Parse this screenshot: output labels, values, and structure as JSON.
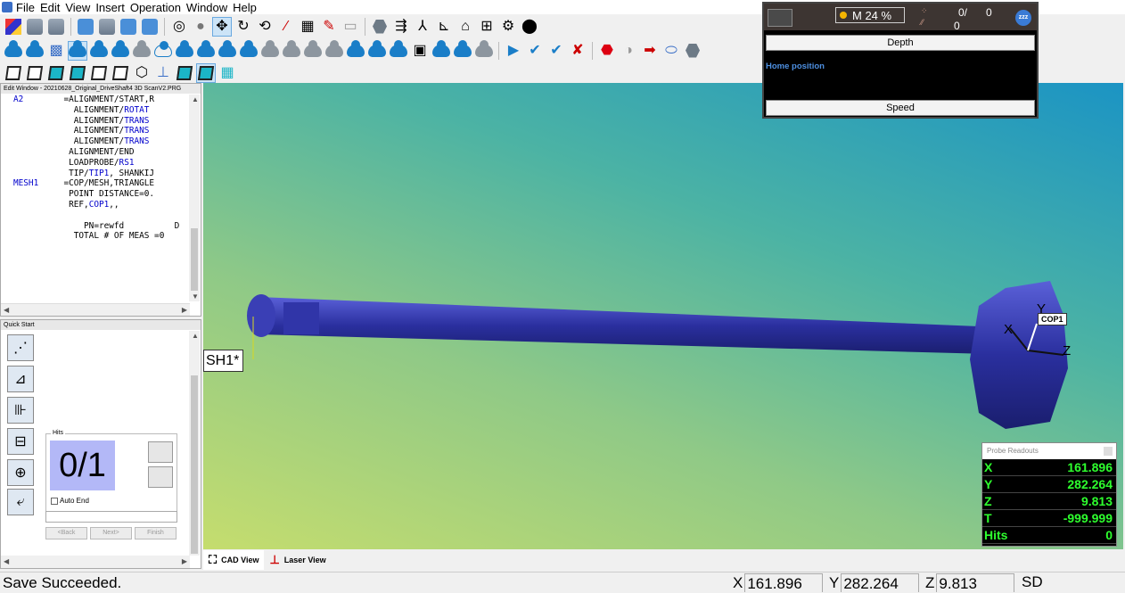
{
  "menu": [
    "File",
    "Edit",
    "View",
    "Insert",
    "Operation",
    "Window",
    "Help"
  ],
  "edit_window": {
    "title": "Edit Window - 20210628_Original_DriveShaft4 3D ScanV2.PRG",
    "lines": [
      {
        "label": "A2",
        "text": "=ALIGNMENT/START,R",
        "keyword": ""
      },
      {
        "label": "",
        "text": "  ALIGNMENT/",
        "keyword": "ROTAT"
      },
      {
        "label": "",
        "text": "  ALIGNMENT/",
        "keyword": "TRANS"
      },
      {
        "label": "",
        "text": "  ALIGNMENT/",
        "keyword": "TRANS"
      },
      {
        "label": "",
        "text": "  ALIGNMENT/",
        "keyword": "TRANS"
      },
      {
        "label": "",
        "text": " ALIGNMENT/END",
        "keyword": ""
      },
      {
        "label": "",
        "text": " LOADPROBE/",
        "keyword": "RS1"
      },
      {
        "label": "",
        "text": " TIP/",
        "keyword": "TIP1",
        "suffix": ", SHANKIJ"
      },
      {
        "label": "MESH1",
        "text": "=COP/MESH,TRIANGLE",
        "keyword": ""
      },
      {
        "label": "",
        "text": " POINT DISTANCE=0.",
        "keyword": ""
      },
      {
        "label": "",
        "text": " REF,",
        "keyword": "COP1",
        "suffix": ",,"
      },
      {
        "label": "",
        "text": "",
        "keyword": ""
      },
      {
        "label": "",
        "text": "    PN=rewfd          D",
        "keyword": ""
      },
      {
        "label": "",
        "text": "  TOTAL # OF MEAS =0      #",
        "keyword": ""
      }
    ]
  },
  "quick_start": {
    "title": "Quick Start",
    "hits_label": "Hits",
    "hits_value": "0/1",
    "auto_end_label": "Auto End",
    "back_label": "<Back",
    "next_label": "Next>",
    "finish_label": "Finish"
  },
  "cad": {
    "mesh_label": "SH1*",
    "cop_label": "COP1",
    "axis_x": "X",
    "axis_y": "Y",
    "axis_z": "Z"
  },
  "probe_readouts": {
    "title": "Probe Readouts",
    "rows": [
      {
        "axis": "X",
        "value": "161.896"
      },
      {
        "axis": "Y",
        "value": "282.264"
      },
      {
        "axis": "Z",
        "value": "9.813"
      },
      {
        "axis": "T",
        "value": "-999.999"
      },
      {
        "axis": "Hits",
        "value": "0"
      }
    ]
  },
  "tabs": {
    "cad_view": "CAD View",
    "laser_view": "Laser View"
  },
  "status": {
    "message": "Save Succeeded.",
    "x_label": "X",
    "x_value": "161.896",
    "y_label": "Y",
    "y_value": "282.264",
    "z_label": "Z",
    "z_value": "9.813",
    "sd_label": "SD"
  },
  "overlay": {
    "zoom": "M 24 %",
    "count_a": "0/",
    "count_b": "0",
    "count_c": "0",
    "zzz": "zzz",
    "depth_label": "Depth",
    "home_label": "Home position",
    "speed_label": "Speed"
  },
  "colors": {
    "readout_green": "#2eff2e",
    "code_keyword": "#0000cc",
    "cad_mesh": "#2a2f9e"
  }
}
